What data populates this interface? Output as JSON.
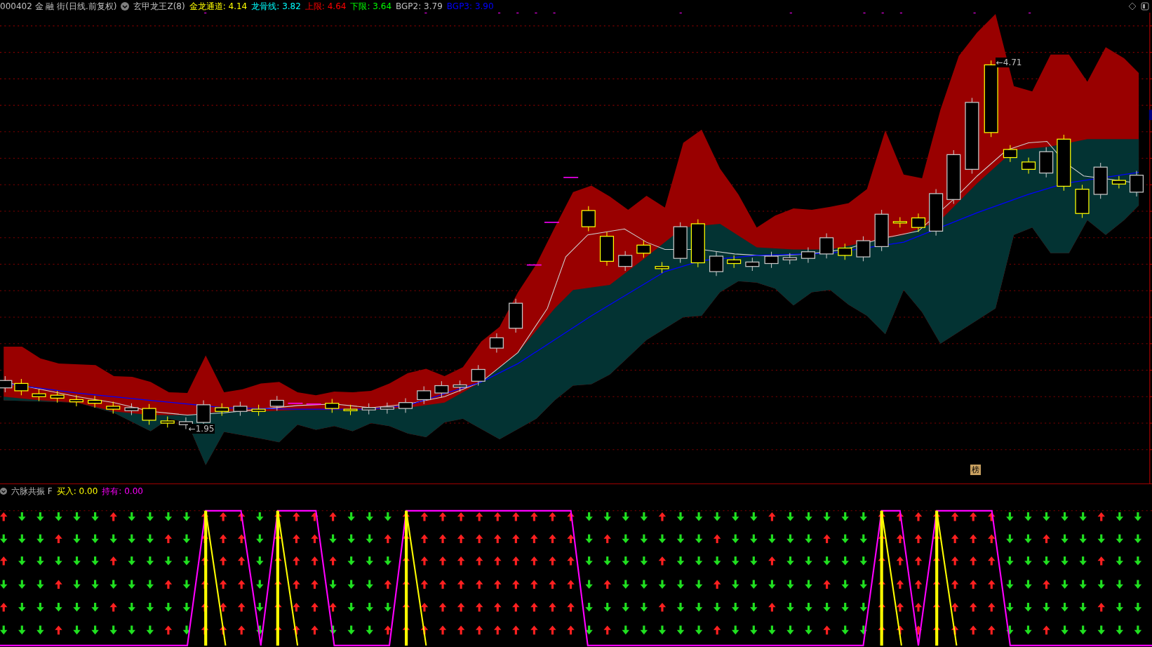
{
  "header": {
    "security": "000402 金 融 街(日线.前复权)",
    "indicator": "玄甲龙王Z(8)",
    "values": [
      {
        "label": "金龙通道:",
        "value": "4.14",
        "color": "#ffff00"
      },
      {
        "label": "龙骨线:",
        "value": "3.82",
        "color": "#00ffff"
      },
      {
        "label": "上限:",
        "value": "4.64",
        "color": "#ff0000"
      },
      {
        "label": "下限:",
        "value": "3.64",
        "color": "#00ff00"
      },
      {
        "label": "BGP2:",
        "value": "3.79",
        "color": "#c0c0c0"
      },
      {
        "label": "BGP3:",
        "value": "3.90",
        "color": "#0000ff"
      }
    ]
  },
  "price_labels": [
    {
      "text": "←1.95",
      "kind": "low"
    },
    {
      "text": "←4.71",
      "kind": "high"
    }
  ],
  "badge": "榜",
  "sub_panel": {
    "title": "六脉共振 F",
    "values": [
      {
        "label": "买入:",
        "value": "0.00",
        "color": "#ffff00"
      },
      {
        "label": "持有:",
        "value": "0.00",
        "color": "#ff00ff"
      }
    ]
  }
}
